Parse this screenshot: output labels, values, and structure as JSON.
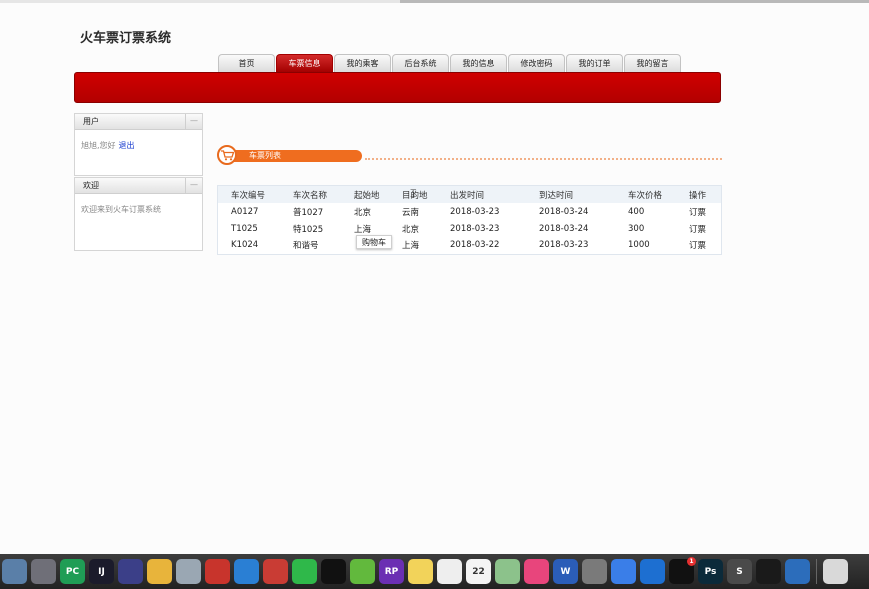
{
  "app": {
    "title": "火车票订票系统"
  },
  "nav": {
    "tabs": [
      {
        "label": "首页"
      },
      {
        "label": "车票信息",
        "active": true
      },
      {
        "label": "我的乘客"
      },
      {
        "label": "后台系统"
      },
      {
        "label": "我的信息"
      },
      {
        "label": "修改密码"
      },
      {
        "label": "我的订单"
      },
      {
        "label": "我的留言"
      }
    ]
  },
  "sidebar": {
    "user_box": {
      "title": "用户",
      "greeting": "旭旭,您好",
      "logout_label": "退出",
      "collapse": "—"
    },
    "welcome_box": {
      "title": "欢迎",
      "text": "欢迎来到火车订票系统",
      "collapse": "—"
    }
  },
  "ticket_list": {
    "title": "车票列表",
    "icon": "cart-icon",
    "columns": [
      "车次编号",
      "车次名称",
      "起始地",
      "目的地",
      "出发时间",
      "到达时间",
      "车次价格",
      "操作"
    ],
    "rows": [
      [
        "A0127",
        "普1027",
        "北京",
        "云南",
        "2018-03-23",
        "2018-03-24",
        "400",
        "订票"
      ],
      [
        "T1025",
        "特1025",
        "上海",
        "北京",
        "2018-03-23",
        "2018-03-24",
        "300",
        "订票"
      ],
      [
        "K1024",
        "和谐号",
        "",
        "上海",
        "2018-03-22",
        "2018-03-23",
        "1000",
        "订票"
      ]
    ]
  },
  "tooltip": {
    "text": "购物车"
  },
  "colors": {
    "primary_red": "#c00000",
    "accent_orange": "#ef6d1f",
    "link_blue": "#1a3ccf"
  },
  "dock": {
    "items": [
      {
        "name": "preview-icon",
        "color": "#5a7fa8"
      },
      {
        "name": "launchpad-icon",
        "color": "#6f6f78"
      },
      {
        "name": "pycharm-icon",
        "color": "#1f9d55",
        "label": "PC"
      },
      {
        "name": "intellij-icon",
        "color": "#1b1b2b",
        "label": "IJ"
      },
      {
        "name": "eclipse-icon",
        "color": "#3b3f88"
      },
      {
        "name": "sequel-pro-icon",
        "color": "#e8b43b"
      },
      {
        "name": "database-icon",
        "color": "#9aa7b3"
      },
      {
        "name": "redis-icon",
        "color": "#c8342c"
      },
      {
        "name": "safari-icon",
        "color": "#2a7fd4"
      },
      {
        "name": "screen-sharing-icon",
        "color": "#c93c34"
      },
      {
        "name": "wechat-icon",
        "color": "#2fb84a"
      },
      {
        "name": "qq-icon",
        "color": "#111111"
      },
      {
        "name": "music-icon",
        "color": "#62b93d"
      },
      {
        "name": "axure-icon",
        "color": "#6b2fb3",
        "label": "RP"
      },
      {
        "name": "notes-icon",
        "color": "#f2d35a"
      },
      {
        "name": "reminders-icon",
        "color": "#eeeeee"
      },
      {
        "name": "calendar-icon",
        "color": "#f4f4f4",
        "label": "22"
      },
      {
        "name": "maps-icon",
        "color": "#8cc28b"
      },
      {
        "name": "itunes-icon",
        "color": "#e8457c"
      },
      {
        "name": "word-icon",
        "color": "#2b5db8",
        "label": "W"
      },
      {
        "name": "system-preferences-icon",
        "color": "#7a7a7a"
      },
      {
        "name": "baidu-netdisk-icon",
        "color": "#3a7ee8"
      },
      {
        "name": "teamviewer-icon",
        "color": "#1d6fd1"
      },
      {
        "name": "qq-badge-icon",
        "color": "#111111",
        "badge": "1"
      },
      {
        "name": "photoshop-icon",
        "color": "#0b2a3a",
        "label": "Ps"
      },
      {
        "name": "sublime-icon",
        "color": "#4a4a4a",
        "label": "S"
      },
      {
        "name": "terminal-icon",
        "color": "#1a1a1a"
      },
      {
        "name": "edge-icon",
        "color": "#2c6dbb"
      },
      {
        "name": "trash-icon",
        "color": "#d9d9d9"
      }
    ]
  }
}
